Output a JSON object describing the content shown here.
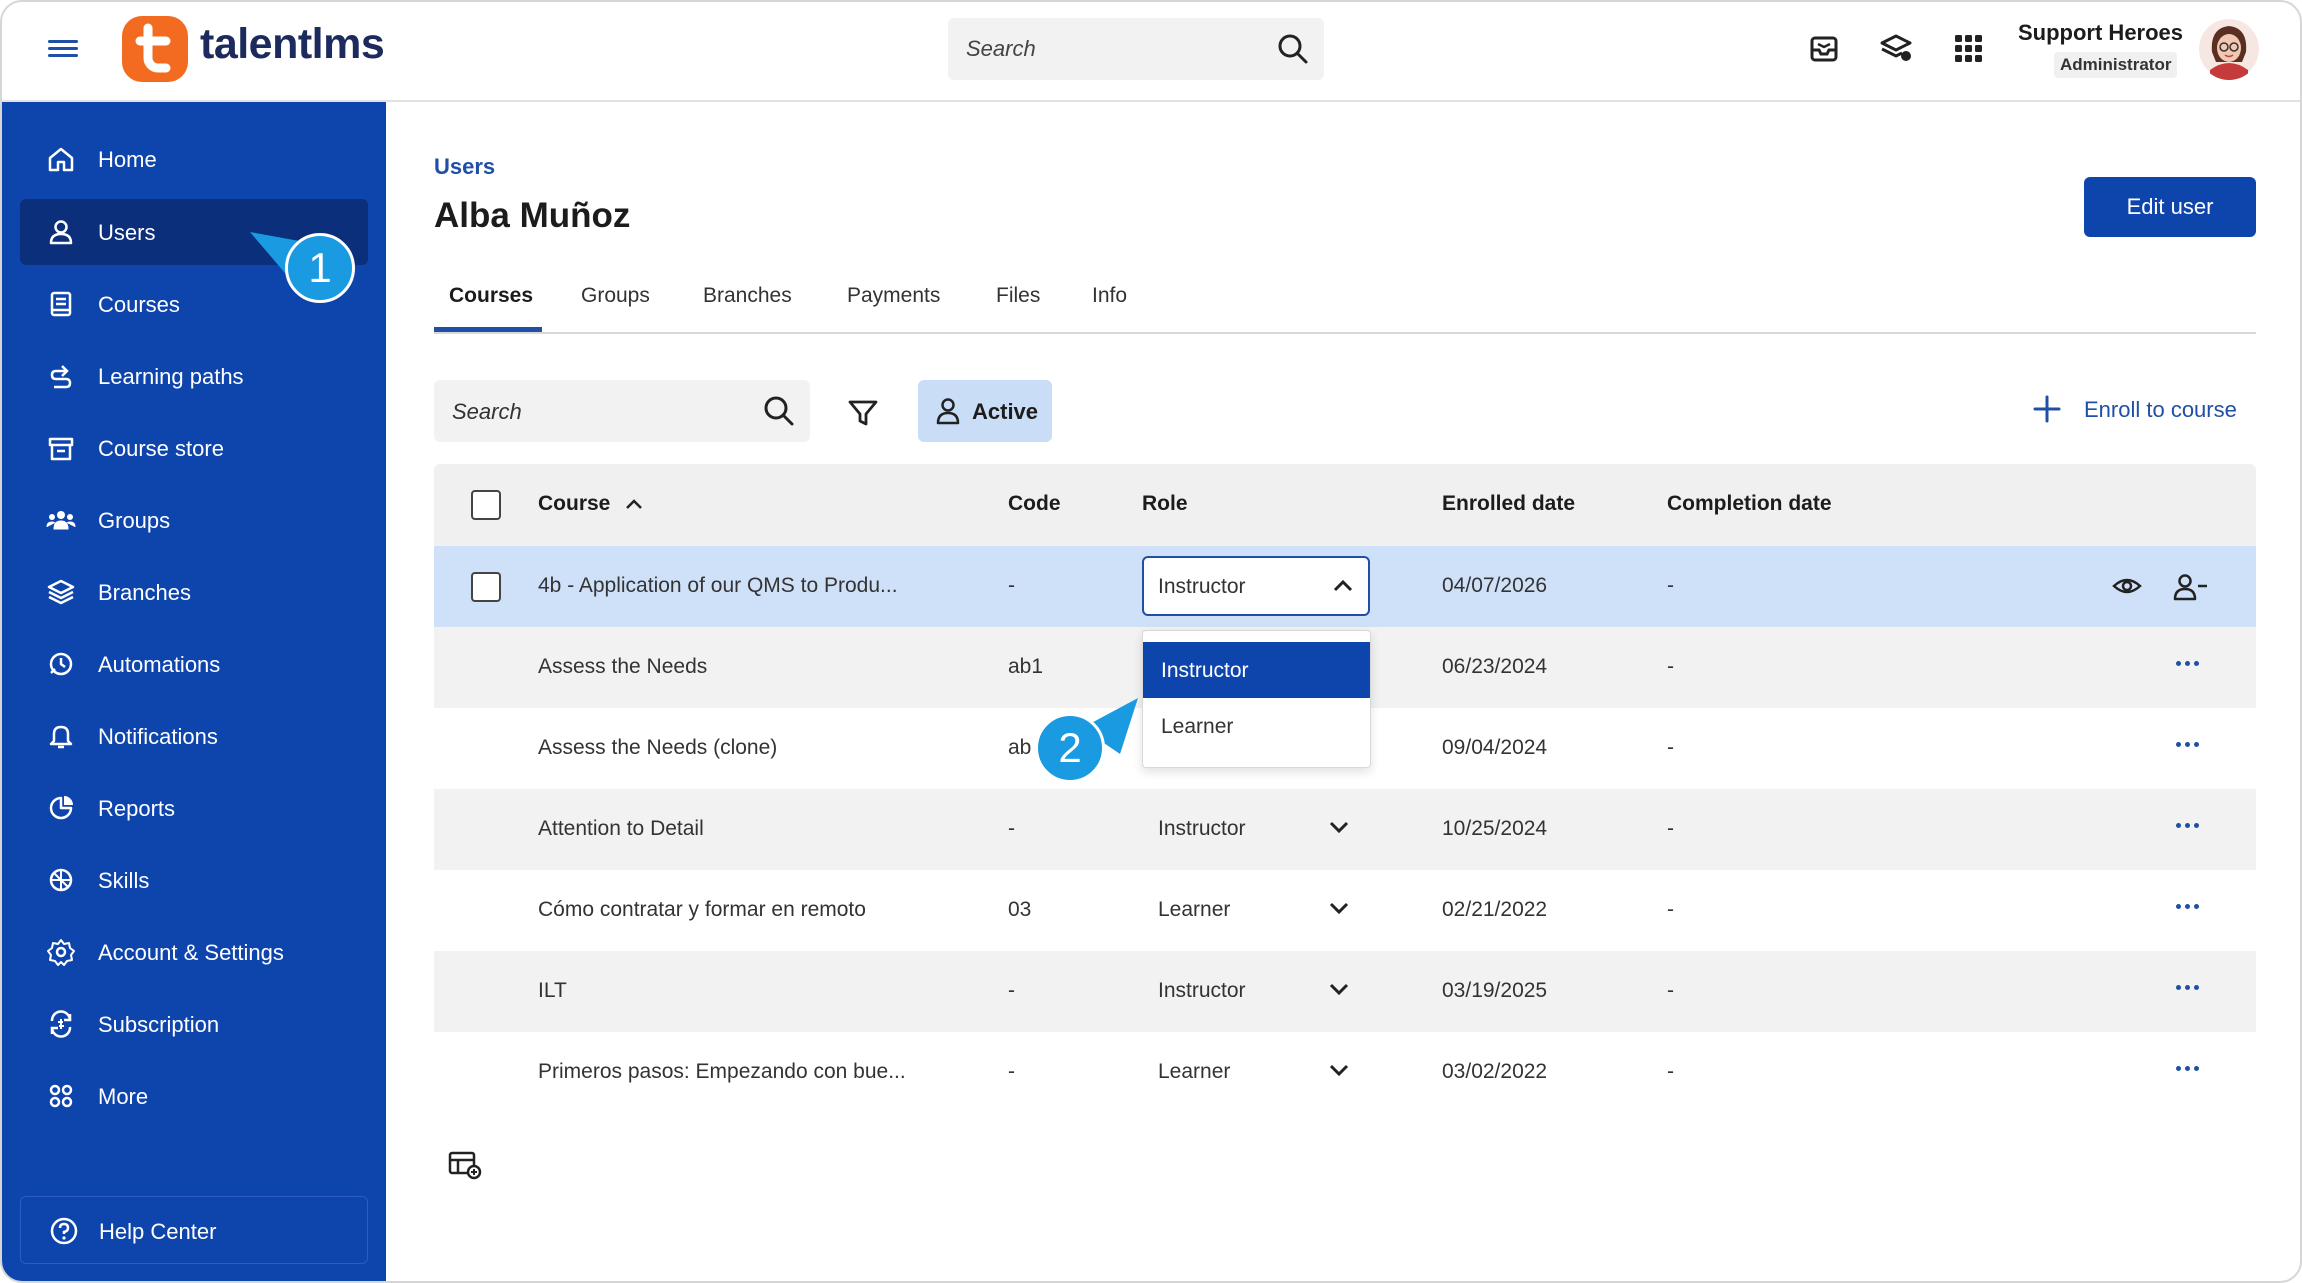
{
  "app": {
    "logo_text": "talentlms"
  },
  "topbar": {
    "search_placeholder": "Search",
    "user_name": "Support Heroes",
    "user_role": "Administrator"
  },
  "sidebar": {
    "items": [
      {
        "label": "Home",
        "icon": "home-icon"
      },
      {
        "label": "Users",
        "icon": "user-icon",
        "active": true
      },
      {
        "label": "Courses",
        "icon": "courses-icon"
      },
      {
        "label": "Learning paths",
        "icon": "learning-paths-icon"
      },
      {
        "label": "Course store",
        "icon": "store-icon"
      },
      {
        "label": "Groups",
        "icon": "groups-icon"
      },
      {
        "label": "Branches",
        "icon": "branches-icon"
      },
      {
        "label": "Automations",
        "icon": "automations-icon"
      },
      {
        "label": "Notifications",
        "icon": "notifications-icon"
      },
      {
        "label": "Reports",
        "icon": "reports-icon"
      },
      {
        "label": "Skills",
        "icon": "skills-icon"
      },
      {
        "label": "Account & Settings",
        "icon": "settings-icon"
      },
      {
        "label": "Subscription",
        "icon": "subscription-icon"
      },
      {
        "label": "More",
        "icon": "more-icon"
      }
    ],
    "help_center": "Help Center"
  },
  "page": {
    "breadcrumb": "Users",
    "title": "Alba Muñoz",
    "edit_button": "Edit user",
    "tabs": [
      "Courses",
      "Groups",
      "Branches",
      "Payments",
      "Files",
      "Info"
    ],
    "active_tab": "Courses",
    "search_placeholder": "Search",
    "active_filter": "Active",
    "enroll_label": "Enroll to course"
  },
  "table": {
    "columns": [
      "Course",
      "Code",
      "Role",
      "Enrolled date",
      "Completion date"
    ],
    "rows": [
      {
        "course": "4b - Application of our QMS to Produ...",
        "code": "-",
        "role": "Instructor",
        "enrolled": "04/07/2026",
        "completion": "-"
      },
      {
        "course": "Assess the Needs",
        "code": "ab1",
        "role": "",
        "enrolled": "06/23/2024",
        "completion": "-"
      },
      {
        "course": "Assess the Needs (clone)",
        "code": "ab",
        "role": "",
        "enrolled": "09/04/2024",
        "completion": "-"
      },
      {
        "course": "Attention to Detail",
        "code": "-",
        "role": "Instructor",
        "enrolled": "10/25/2024",
        "completion": "-"
      },
      {
        "course": "Cómo contratar y formar en remoto",
        "code": "03",
        "role": "Learner",
        "enrolled": "02/21/2022",
        "completion": "-"
      },
      {
        "course": "ILT",
        "code": "-",
        "role": "Instructor",
        "enrolled": "03/19/2025",
        "completion": "-"
      },
      {
        "course": "Primeros pasos: Empezando con bue...",
        "code": "-",
        "role": "Learner",
        "enrolled": "03/02/2022",
        "completion": "-"
      }
    ]
  },
  "role_dropdown": {
    "options": [
      "Instructor",
      "Learner"
    ],
    "selected": "Instructor"
  },
  "callouts": [
    "1",
    "2"
  ],
  "colors": {
    "sidebar": "#0e45ad",
    "accent": "#1f4fa6",
    "logo": "#f26b21",
    "selected_row": "#cfe0f9",
    "callout": "#1a9ae0"
  }
}
